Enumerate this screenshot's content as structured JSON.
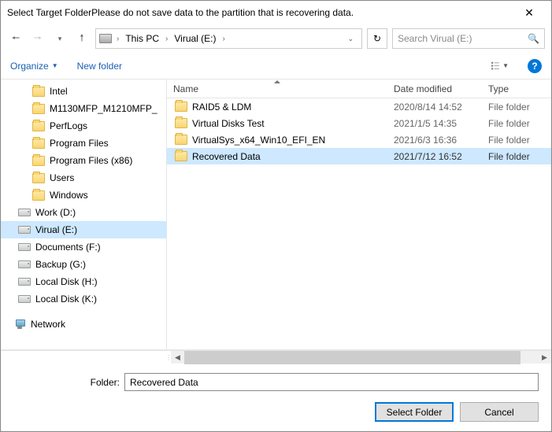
{
  "title": "Select Target FolderPlease do not save data to the partition that is recovering data.",
  "path": {
    "crumb1": "This PC",
    "crumb2": "Virual (E:)"
  },
  "search": {
    "placeholder": "Search Virual (E:)"
  },
  "toolbar": {
    "organize": "Organize",
    "newfolder": "New folder"
  },
  "tree": {
    "intel": "Intel",
    "m1130": "M1130MFP_M1210MFP_",
    "perflogs": "PerfLogs",
    "progfiles": "Program Files",
    "progfilesx86": "Program Files (x86)",
    "users": "Users",
    "windows": "Windows",
    "workd": "Work (D:)",
    "viruale": "Virual (E:)",
    "documentsf": "Documents (F:)",
    "backupg": "Backup (G:)",
    "localh": "Local Disk (H:)",
    "localk": "Local Disk (K:)",
    "network": "Network"
  },
  "columns": {
    "name": "Name",
    "date": "Date modified",
    "type": "Type"
  },
  "rows": [
    {
      "name": "RAID5 & LDM",
      "date": "2020/8/14 14:52",
      "type": "File folder"
    },
    {
      "name": "Virtual Disks Test",
      "date": "2021/1/5 14:35",
      "type": "File folder"
    },
    {
      "name": "VirtualSys_x64_Win10_EFI_EN",
      "date": "2021/6/3 16:36",
      "type": "File folder"
    },
    {
      "name": "Recovered Data",
      "date": "2021/7/12 16:52",
      "type": "File folder"
    }
  ],
  "folderLabel": "Folder:",
  "folderValue": "Recovered Data",
  "buttons": {
    "select": "Select Folder",
    "cancel": "Cancel"
  },
  "help": "?"
}
